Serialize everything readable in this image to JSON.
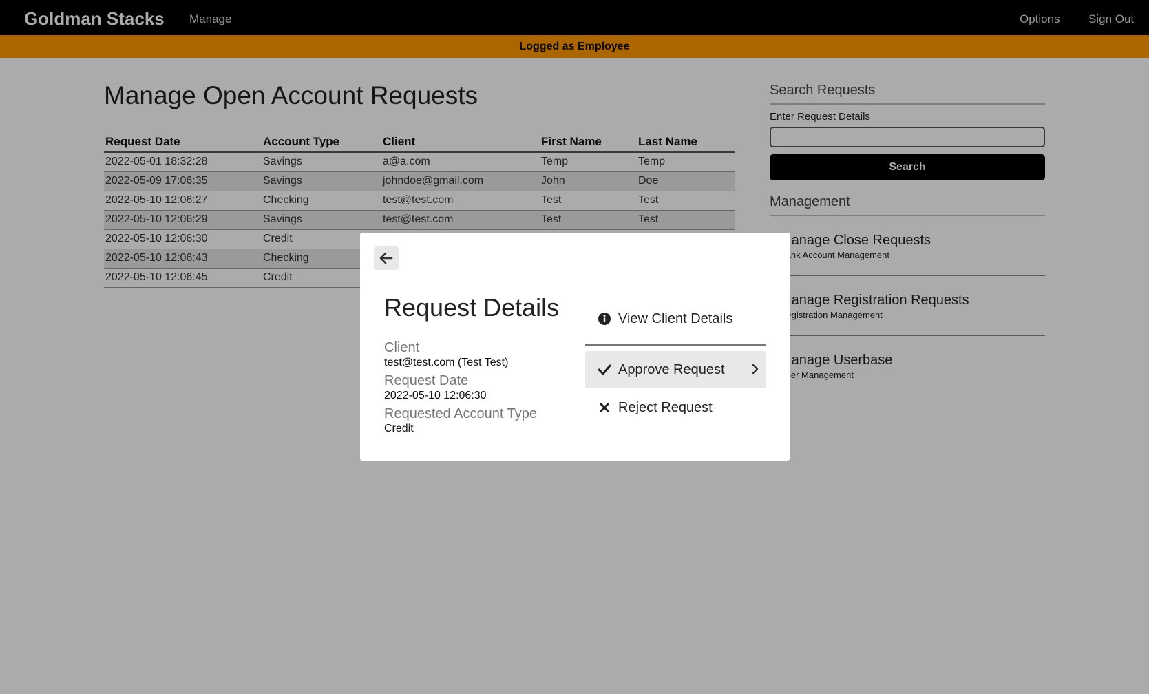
{
  "navbar": {
    "brand": "Goldman Stacks",
    "manage_link": "Manage",
    "options_link": "Options",
    "signout_link": "Sign Out"
  },
  "role_banner": "Logged as Employee",
  "main": {
    "title": "Manage Open Account Requests",
    "table": {
      "headers": [
        "Request Date",
        "Account Type",
        "Client",
        "First Name",
        "Last Name"
      ],
      "rows": [
        [
          "2022-05-01 18:32:28",
          "Savings",
          "a@a.com",
          "Temp",
          "Temp"
        ],
        [
          "2022-05-09 17:06:35",
          "Savings",
          "johndoe@gmail.com",
          "John",
          "Doe"
        ],
        [
          "2022-05-10 12:06:27",
          "Checking",
          "test@test.com",
          "Test",
          "Test"
        ],
        [
          "2022-05-10 12:06:29",
          "Savings",
          "test@test.com",
          "Test",
          "Test"
        ],
        [
          "2022-05-10 12:06:30",
          "Credit",
          "",
          "",
          ""
        ],
        [
          "2022-05-10 12:06:43",
          "Checking",
          "",
          "",
          ""
        ],
        [
          "2022-05-10 12:06:45",
          "Credit",
          "",
          "",
          ""
        ]
      ]
    }
  },
  "sidebar": {
    "search_heading": "Search Requests",
    "search_label": "Enter Request Details",
    "search_placeholder": "",
    "search_button": "Search",
    "management_heading": "Management",
    "items": [
      {
        "title": "Manage Close Requests",
        "subtitle": "Bank Account Management"
      },
      {
        "title": "Manage Registration Requests",
        "subtitle": "Registration Management"
      },
      {
        "title": "Manage Userbase",
        "subtitle": "User Management"
      }
    ]
  },
  "modal": {
    "title": "Request Details",
    "details": {
      "client_label": "Client",
      "client_value": "test@test.com (Test Test)",
      "date_label": "Request Date",
      "date_value": "2022-05-10 12:06:30",
      "type_label": "Requested Account Type",
      "type_value": "Credit"
    },
    "actions": {
      "view_client": "View Client Details",
      "approve": "Approve Request",
      "reject": "Reject Request"
    }
  },
  "colors": {
    "navbar": "#000000",
    "role_banner": "#ff9900",
    "overlay": "rgba(0,0,0,0.33)",
    "modal_bg": "#ffffff"
  }
}
